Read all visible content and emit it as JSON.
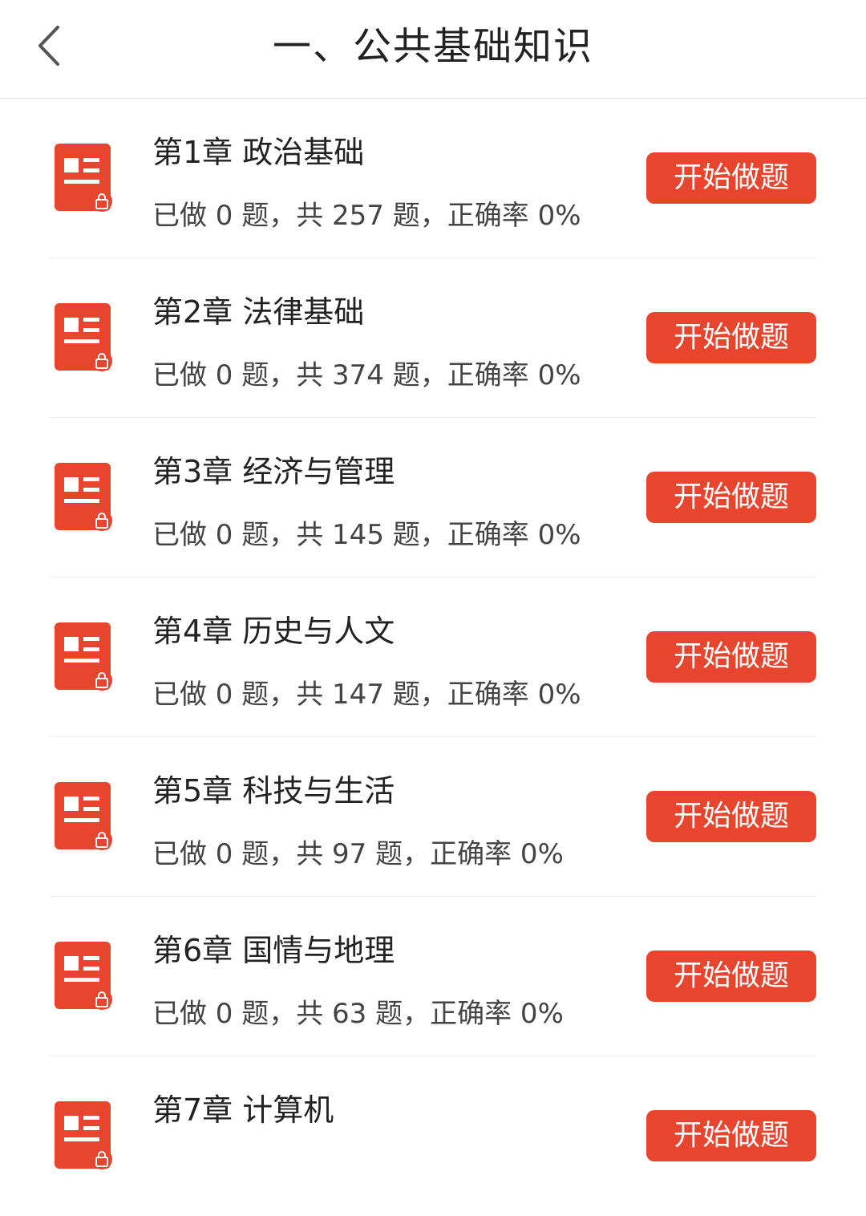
{
  "header": {
    "title": "一、公共基础知识",
    "back_icon": "chevron-left-icon"
  },
  "colors": {
    "accent": "#e8452e",
    "text": "#222222",
    "divider": "#ececec"
  },
  "chapters": [
    {
      "title": "第1章 政治基础",
      "stats": "已做 0 题，共 257 题，正确率 0%",
      "button": "开始做题"
    },
    {
      "title": "第2章 法律基础",
      "stats": "已做 0 题，共 374 题，正确率 0%",
      "button": "开始做题"
    },
    {
      "title": "第3章 经济与管理",
      "stats": "已做 0 题，共 145 题，正确率 0%",
      "button": "开始做题"
    },
    {
      "title": "第4章 历史与人文",
      "stats": "已做 0 题，共 147 题，正确率 0%",
      "button": "开始做题"
    },
    {
      "title": "第5章 科技与生活",
      "stats": "已做 0 题，共 97 题，正确率 0%",
      "button": "开始做题"
    },
    {
      "title": "第6章 国情与地理",
      "stats": "已做 0 题，共 63 题，正确率 0%",
      "button": "开始做题"
    },
    {
      "title": "第7章 计算机",
      "stats": "",
      "button": "开始做题"
    }
  ]
}
